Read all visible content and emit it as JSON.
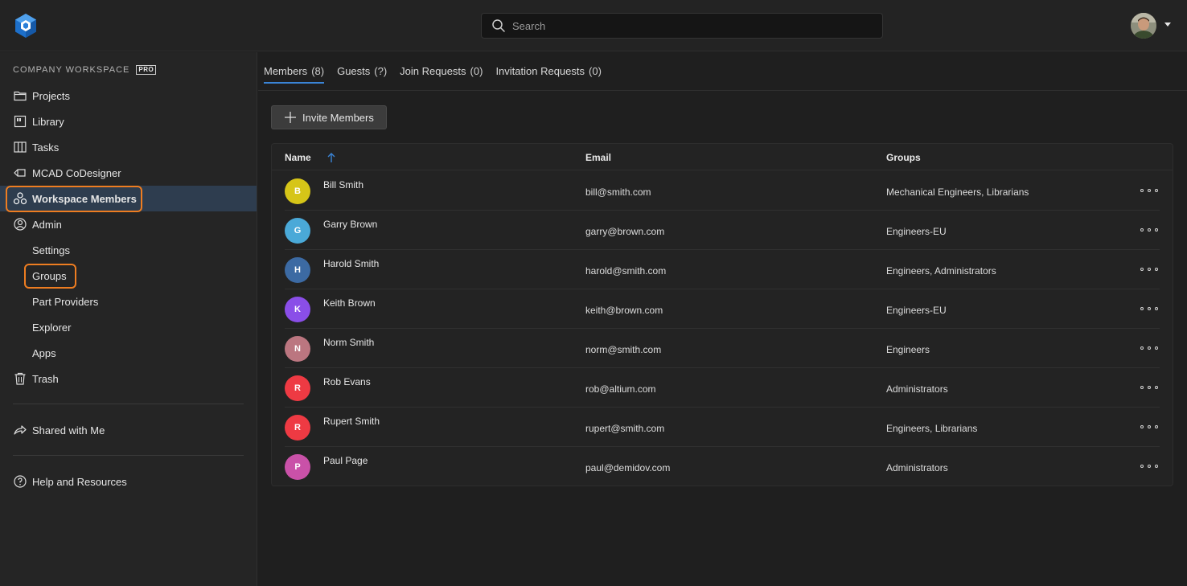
{
  "header": {
    "search_placeholder": "Search"
  },
  "sidebar": {
    "workspace_label": "COMPANY WORKSPACE",
    "pro_badge": "PRO",
    "items": [
      {
        "label": "Projects",
        "icon": "folder-icon"
      },
      {
        "label": "Library",
        "icon": "library-icon"
      },
      {
        "label": "Tasks",
        "icon": "tasks-icon"
      },
      {
        "label": "MCAD CoDesigner",
        "icon": "mcad-icon"
      },
      {
        "label": "Workspace Members",
        "icon": "members-icon",
        "active": true
      },
      {
        "label": "Admin",
        "icon": "admin-icon"
      },
      {
        "label": "Settings"
      },
      {
        "label": "Groups"
      },
      {
        "label": "Part Providers"
      },
      {
        "label": "Explorer"
      },
      {
        "label": "Apps"
      },
      {
        "label": "Trash",
        "icon": "trash-icon"
      },
      {
        "label": "Shared with Me",
        "icon": "share-icon"
      },
      {
        "label": "Help and Resources",
        "icon": "help-icon"
      }
    ]
  },
  "tabs": [
    {
      "label": "Members",
      "count": "(8)",
      "active": true
    },
    {
      "label": "Guests",
      "count": "(?)"
    },
    {
      "label": "Join Requests",
      "count": "(0)"
    },
    {
      "label": "Invitation Requests",
      "count": "(0)"
    }
  ],
  "invite_button": "Invite Members",
  "table": {
    "columns": [
      "Name",
      "Email",
      "Groups"
    ],
    "sort": {
      "column": "Name",
      "direction": "ascending"
    },
    "rows": [
      {
        "initial": "B",
        "color": "#d6c518",
        "name": "Bill Smith",
        "email": "bill@smith.com",
        "groups": "Mechanical Engineers, Librarians"
      },
      {
        "initial": "G",
        "color": "#4aa9d8",
        "name": "Garry Brown",
        "email": "garry@brown.com",
        "groups": "Engineers-EU"
      },
      {
        "initial": "H",
        "color": "#3c6aa3",
        "name": "Harold Smith",
        "email": "harold@smith.com",
        "groups": "Engineers, Administrators"
      },
      {
        "initial": "K",
        "color": "#8a4ee8",
        "name": "Keith Brown",
        "email": "keith@brown.com",
        "groups": "Engineers-EU"
      },
      {
        "initial": "N",
        "color": "#bb7680",
        "name": "Norm Smith",
        "email": "norm@smith.com",
        "groups": "Engineers"
      },
      {
        "initial": "R",
        "color": "#ee3a43",
        "name": "Rob Evans",
        "email": "rob@altium.com",
        "groups": "Administrators"
      },
      {
        "initial": "R",
        "color": "#ee3a43",
        "name": "Rupert Smith",
        "email": "rupert@smith.com",
        "groups": "Engineers, Librarians"
      },
      {
        "initial": "P",
        "color": "#c951a8",
        "name": "Paul Page",
        "email": "paul@demidov.com",
        "groups": "Administrators"
      }
    ]
  },
  "colors": {
    "accent": "#3a84d6",
    "highlight": "#ee7d21",
    "active_nav": "#2e3d4f"
  }
}
